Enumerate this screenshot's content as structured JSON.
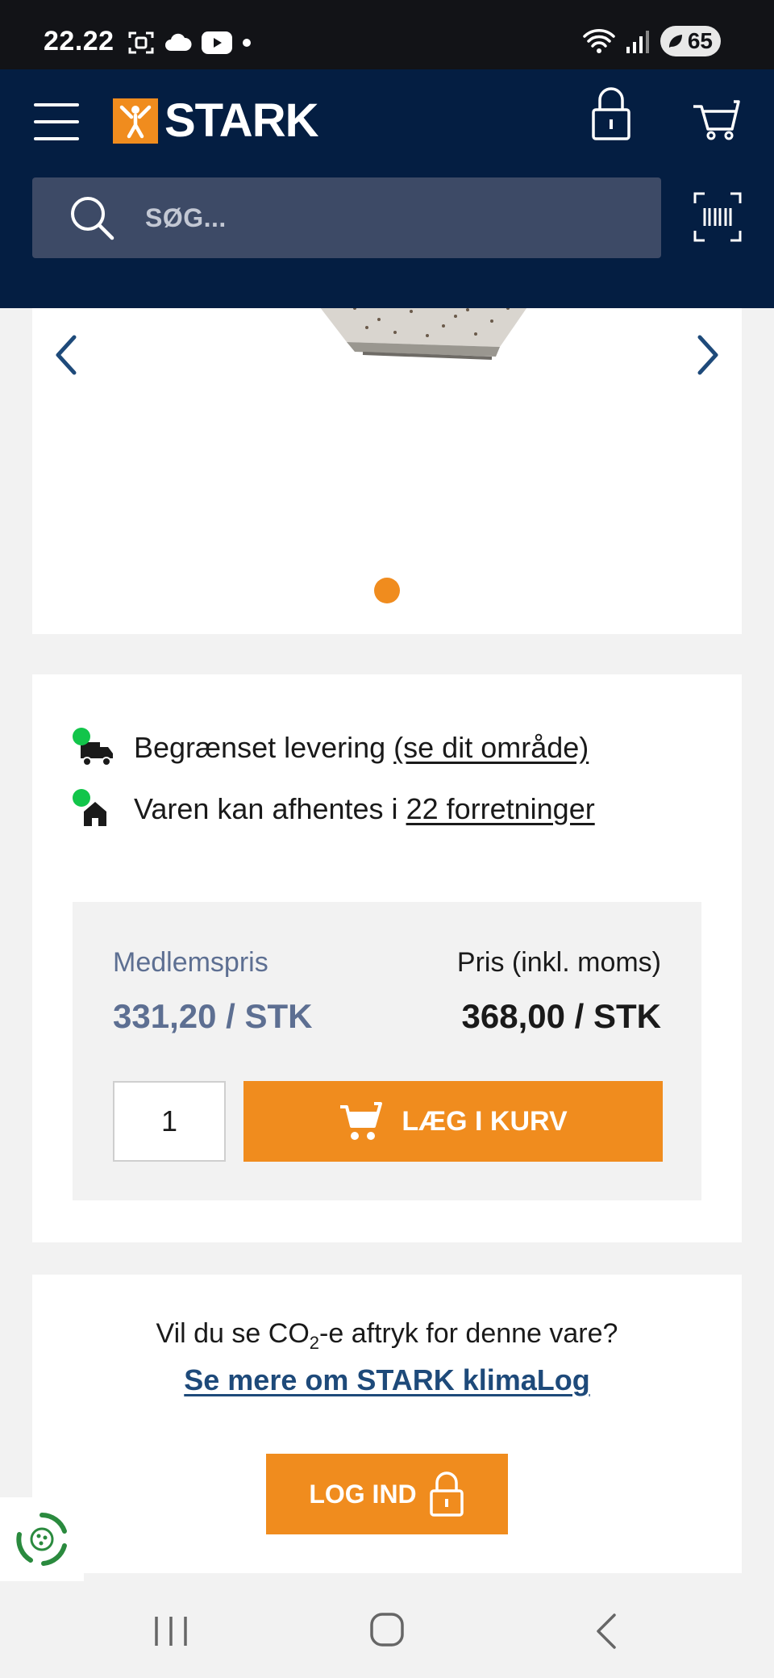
{
  "status_bar": {
    "time": "22.22",
    "battery": "65",
    "icons": [
      "screenshot-icon",
      "cloud-icon",
      "youtube-icon",
      "notification-dot-icon",
      "wifi-icon",
      "signal-icon",
      "battery-icon"
    ]
  },
  "header": {
    "logo_text": "STARK",
    "search_placeholder": "SØG...",
    "brand_colors": {
      "navy": "#041e42",
      "orange": "#f08c1e"
    }
  },
  "gallery": {
    "active_slide": 1,
    "total_slides": 1
  },
  "availability": {
    "delivery_text": "Begrænset levering ",
    "delivery_link": "(se dit område)",
    "pickup_text": "Varen kan afhentes i ",
    "pickup_link": "22 forretninger",
    "status_color": "#12c54a"
  },
  "pricing": {
    "member_label": "Medlemspris",
    "member_price": "331,20 / STK",
    "price_label": "Pris (inkl. moms)",
    "price_value": "368,00 / STK",
    "quantity": "1",
    "add_to_cart_label": "LÆG I KURV"
  },
  "climate": {
    "question_prefix": "Vil du se CO",
    "question_sub": "2",
    "question_suffix": "-e aftryk for denne vare?",
    "link_label": "Se mere om STARK klimaLog",
    "login_label": "LOG IND"
  }
}
